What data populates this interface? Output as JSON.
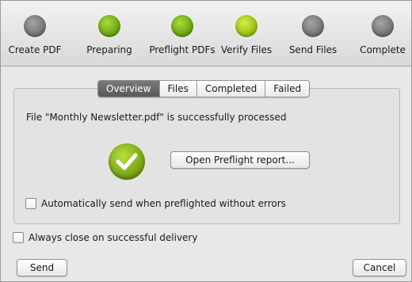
{
  "steps": [
    {
      "label": "Create PDF",
      "state": "gray"
    },
    {
      "label": "Preparing",
      "state": "green"
    },
    {
      "label": "Preflight PDFs",
      "state": "green"
    },
    {
      "label": "Verify Files",
      "state": "lime"
    },
    {
      "label": "Send Files",
      "state": "gray"
    },
    {
      "label": "Complete",
      "state": "gray"
    }
  ],
  "tabs": [
    {
      "label": "Overview",
      "active": true
    },
    {
      "label": "Files",
      "active": false
    },
    {
      "label": "Completed",
      "active": false
    },
    {
      "label": "Failed",
      "active": false
    }
  ],
  "overview": {
    "status_text": "File \"Monthly Newsletter.pdf\" is successfully processed",
    "open_report_label": "Open Preflight report...",
    "auto_send_label": "Automatically send when preflighted without errors",
    "auto_send_checked": false
  },
  "footer": {
    "always_close_label": "Always close on successful delivery",
    "always_close_checked": false,
    "send_label": "Send",
    "cancel_label": "Cancel"
  },
  "colors": {
    "step_gray": "#7a7a7a",
    "step_green": "#7fc21c",
    "step_lime": "#b5d626",
    "success_green": "#8fc21f"
  }
}
